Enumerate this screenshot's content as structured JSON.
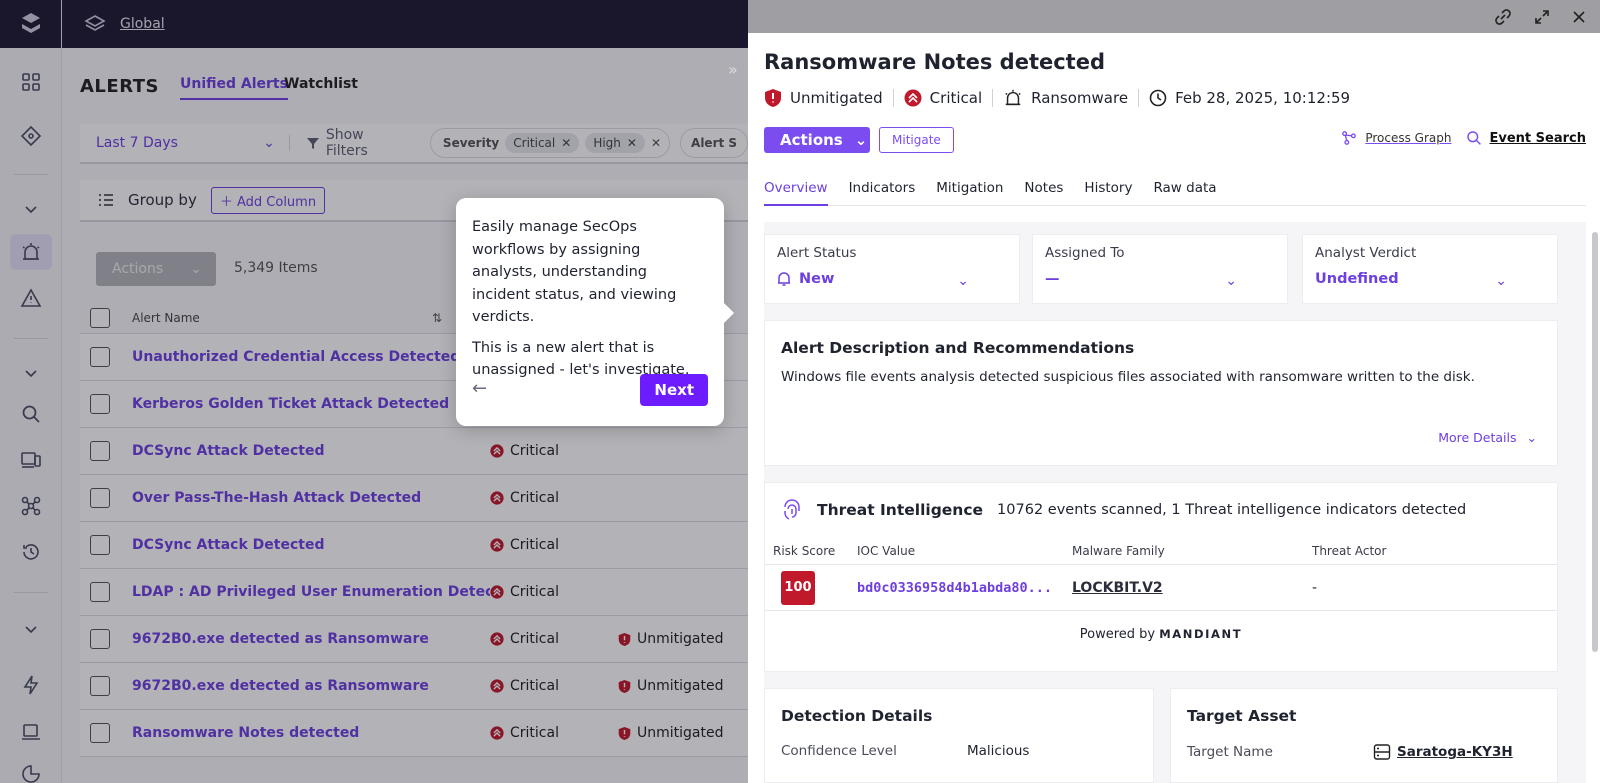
{
  "topbar": {
    "scope": "Global"
  },
  "page": {
    "title": "ALERTS",
    "tabs": [
      "Unified Alerts",
      "Watchlist"
    ]
  },
  "filters": {
    "date_range": "Last 7 Days",
    "show_filters": "Show Filters",
    "severity_label": "Severity",
    "chips": [
      "Critical",
      "High"
    ],
    "next_group": "Alert S"
  },
  "group_bar": {
    "label": "Group by",
    "add_column": "Add Column"
  },
  "table": {
    "actions": "Actions",
    "count": "5,349 Items",
    "col_name": "Alert Name",
    "rows": [
      {
        "name": "Unauthorized Credential Access Detected",
        "severity": "",
        "status": ""
      },
      {
        "name": "Kerberos Golden Ticket Attack Detected",
        "severity": "",
        "status": ""
      },
      {
        "name": "DCSync Attack Detected",
        "severity": "Critical",
        "status": ""
      },
      {
        "name": "Over Pass-The-Hash Attack Detected",
        "severity": "Critical",
        "status": ""
      },
      {
        "name": "DCSync Attack Detected",
        "severity": "Critical",
        "status": ""
      },
      {
        "name": "LDAP : AD Privileged User Enumeration Detected",
        "severity": "Critical",
        "status": ""
      },
      {
        "name": "9672B0.exe detected as Ransomware",
        "severity": "Critical",
        "status": "Unmitigated"
      },
      {
        "name": "9672B0.exe detected as Ransomware",
        "severity": "Critical",
        "status": "Unmitigated"
      },
      {
        "name": "Ransomware Notes detected",
        "severity": "Critical",
        "status": "Unmitigated"
      }
    ]
  },
  "tooltip": {
    "p1": "Easily manage SecOps workflows by assigning analysts, understanding incident status, and viewing verdicts.",
    "p2": "This is a new alert that is unassigned - let's investigate.",
    "next": "Next"
  },
  "panel": {
    "title": "Ransomware Notes detected",
    "status": "Unmitigated",
    "severity": "Critical",
    "category": "Ransomware",
    "timestamp": "Feb 28, 2025, 10:12:59",
    "actions": "Actions",
    "mitigate": "Mitigate",
    "process_graph": "Process Graph",
    "event_search": "Event Search",
    "tabs": [
      "Overview",
      "Indicators",
      "Mitigation",
      "Notes",
      "History",
      "Raw data"
    ],
    "status_fields": [
      {
        "label": "Alert Status",
        "value": "New"
      },
      {
        "label": "Assigned To",
        "value": "—"
      },
      {
        "label": "Analyst Verdict",
        "value": "Undefined"
      }
    ],
    "description": {
      "title": "Alert Description and Recommendations",
      "text": "Windows file events analysis detected suspicious files associated with ransomware written to the disk.",
      "more": "More Details"
    },
    "threat_intel": {
      "title": "Threat Intelligence",
      "summary": "10762 events scanned, 1 Threat intelligence indicators detected",
      "columns": [
        "Risk Score",
        "IOC Value",
        "Malware Family",
        "Threat Actor"
      ],
      "row": {
        "score": "100",
        "ioc": "bd0c0336958d4b1abda80...",
        "family": "LOCKBIT.V2",
        "actor": "-"
      },
      "powered": "Powered by",
      "brand": "MANDIANT"
    },
    "detection": {
      "title": "Detection Details",
      "k": "Confidence Level",
      "v": "Malicious"
    },
    "target": {
      "title": "Target Asset",
      "k": "Target Name",
      "v": "Saratoga-KY3H"
    }
  },
  "colors": {
    "accent": "#6d3fe0",
    "critical": "#c0192c",
    "topbar": "#1e1a33"
  }
}
